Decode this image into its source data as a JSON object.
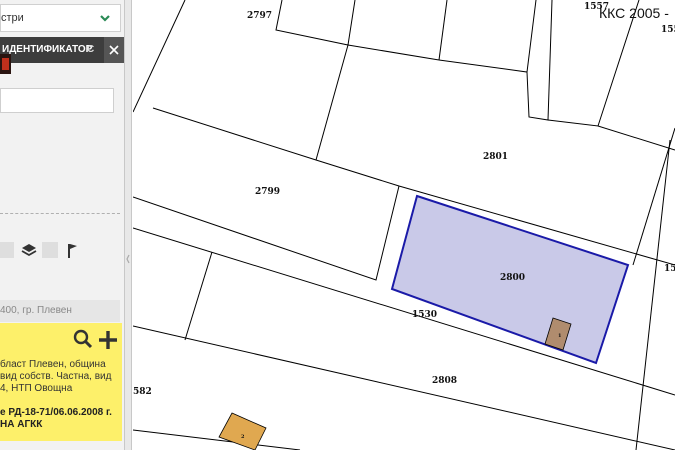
{
  "sidebar": {
    "registry_select_value": "стри",
    "identifier_bar_label": "ИДЕНТИФИКАТОР",
    "identifier_bar_extra": "С",
    "address_text": "400, гр. Плевен",
    "info": {
      "lines": [
        "бласт Плевен, община",
        "вид собств. Частна, вид",
        "4, НТП Овощна"
      ],
      "bold_lines": [
        "е РД-18-71/06.06.2008 г.",
        "НА АГКК"
      ]
    }
  },
  "map": {
    "caption": "ККС 2005 -",
    "parcel_labels": {
      "p2797": "2797",
      "p2801": "2801",
      "p2799": "2799",
      "p2800": "2800",
      "p1530": "1530",
      "p2808": "2808",
      "p582": "582",
      "p155a": "1557",
      "p155b": "155",
      "p15": "15",
      "b1": "1",
      "b2": "2"
    },
    "selected_parcel_fill": "#c9c9e8",
    "selected_parcel_stroke": "#1a1aa8",
    "building_fill": "#b08c6e",
    "building_orange_fill": "#e0a850"
  }
}
